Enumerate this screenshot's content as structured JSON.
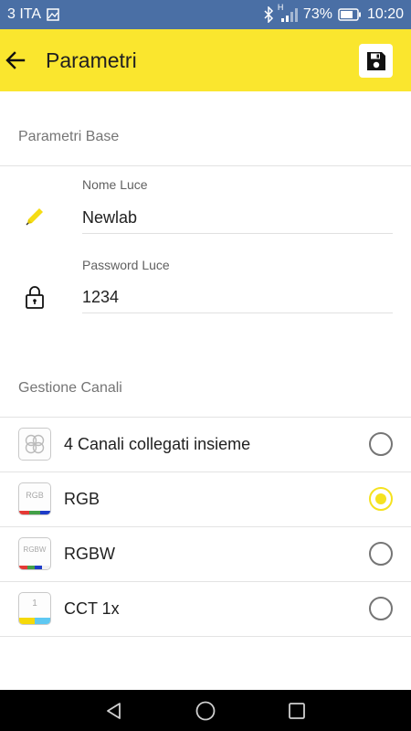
{
  "status_bar": {
    "carrier": "3 ITA",
    "battery_percent": "73%",
    "time": "10:20",
    "icons": [
      "image-notification-icon",
      "bluetooth-icon",
      "signal-icon",
      "battery-icon"
    ],
    "network_badge": "H"
  },
  "app_bar": {
    "title": "Parametri",
    "back_icon": "arrow-left-icon",
    "save_icon": "floppy-disk-icon",
    "background_color": "#fae62e"
  },
  "basic_params": {
    "header": "Parametri Base",
    "fields": [
      {
        "label": "Nome Luce",
        "value": "Newlab",
        "icon": "pencil-icon"
      },
      {
        "label": "Password Luce",
        "value": "1234",
        "icon": "lock-icon"
      }
    ]
  },
  "channels": {
    "header": "Gestione Canali",
    "options": [
      {
        "label": "4 Canali collegati insieme",
        "icon": "four-channels-icon",
        "icon_text": "",
        "selected": false
      },
      {
        "label": "RGB",
        "icon": "rgb-icon",
        "icon_text": "RGB",
        "selected": true
      },
      {
        "label": "RGBW",
        "icon": "rgbw-icon",
        "icon_text": "RGBW",
        "selected": false
      },
      {
        "label": "CCT 1x",
        "icon": "cct-icon",
        "icon_text": "1",
        "selected": false
      }
    ],
    "accent_color": "#f5e21e"
  },
  "nav_bar": {
    "icons": [
      "back-triangle-icon",
      "home-circle-icon",
      "recents-square-icon"
    ]
  }
}
